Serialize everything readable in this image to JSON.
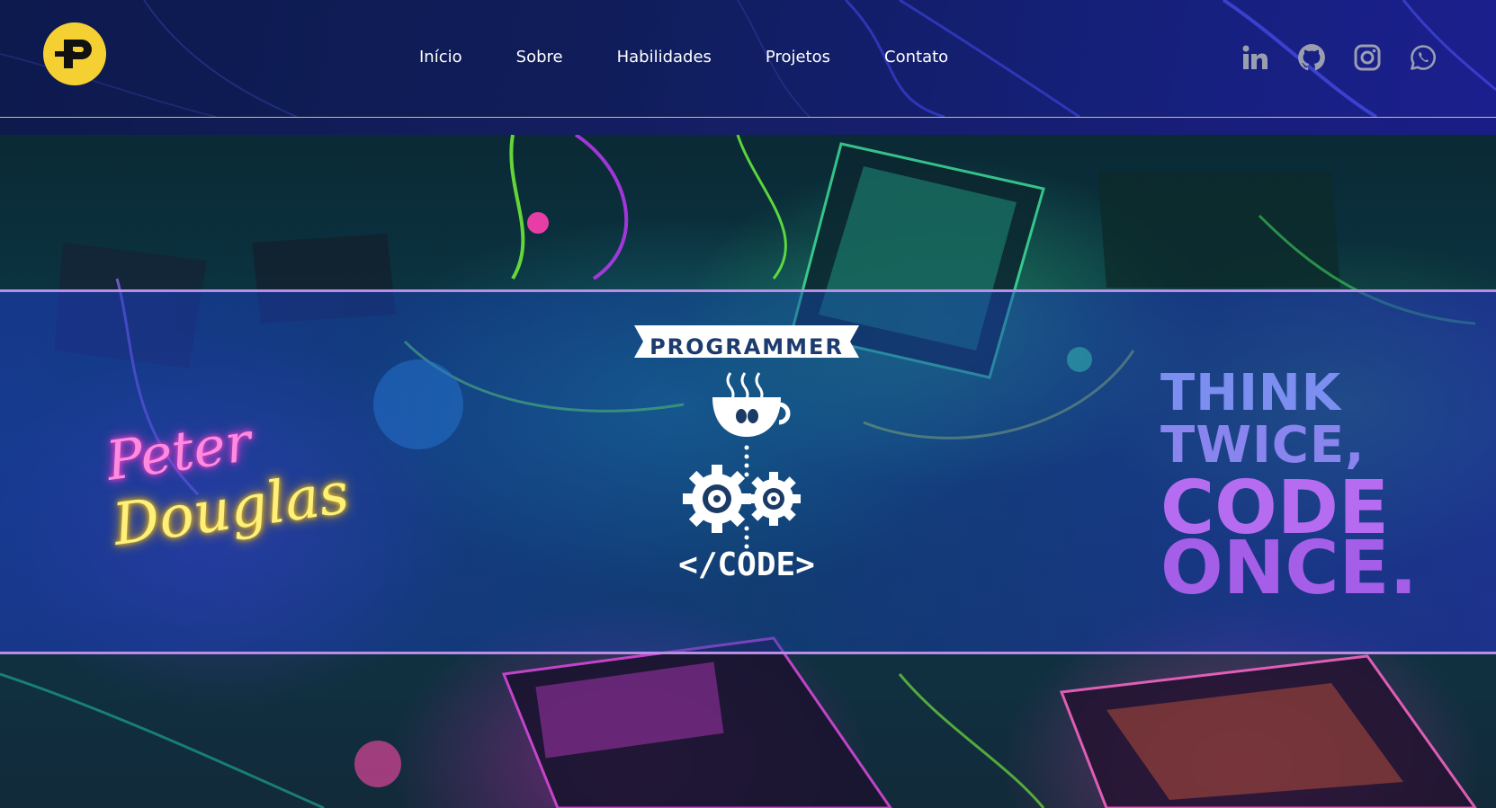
{
  "header": {
    "logo_icon": "p-monogram-icon",
    "logo_color": "#f5d033",
    "accent_line_color": "#d8c24a"
  },
  "nav": {
    "items": [
      "Início",
      "Sobre",
      "Habilidades",
      "Projetos",
      "Contato"
    ]
  },
  "social": {
    "icons": [
      "linkedin-icon",
      "github-icon",
      "instagram-icon",
      "whatsapp-icon"
    ],
    "color": "#9a9fb0"
  },
  "hero": {
    "name_first": "Peter",
    "name_last": "Douglas",
    "badge_label": "PROGRAMMER",
    "badge_code": "</CODE>",
    "quote_line1": "THINK",
    "quote_line2": "TWICE,",
    "quote_line3": "CODE",
    "quote_line4": "ONCE.",
    "band_border_color": "#b98ee6"
  }
}
